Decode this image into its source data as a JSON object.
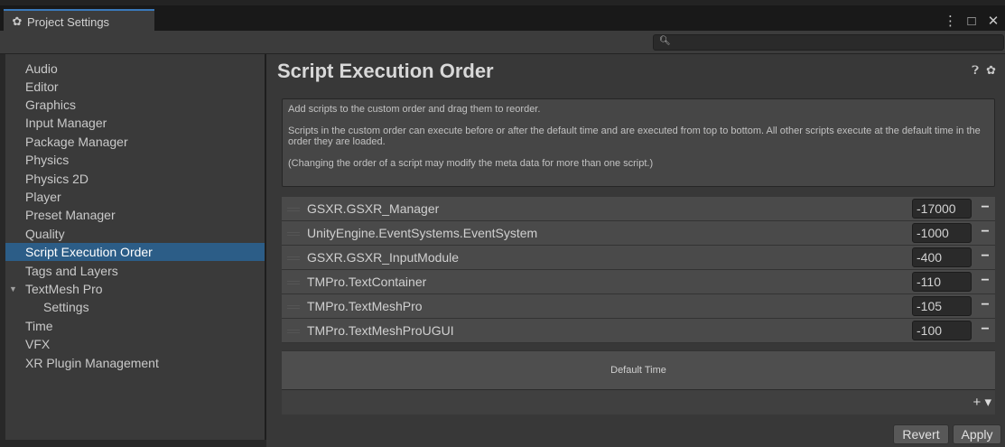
{
  "window": {
    "tab_title": "Project Settings",
    "tab_icon": "gear-icon",
    "controls": [
      "⋮",
      "□",
      "✕"
    ]
  },
  "search": {
    "placeholder": "",
    "value": ""
  },
  "sidebar": {
    "items": [
      {
        "label": "Audio"
      },
      {
        "label": "Editor"
      },
      {
        "label": "Graphics"
      },
      {
        "label": "Input Manager"
      },
      {
        "label": "Package Manager"
      },
      {
        "label": "Physics"
      },
      {
        "label": "Physics 2D"
      },
      {
        "label": "Player"
      },
      {
        "label": "Preset Manager"
      },
      {
        "label": "Quality"
      },
      {
        "label": "Script Execution Order",
        "selected": true
      },
      {
        "label": "Tags and Layers"
      },
      {
        "label": "TextMesh Pro",
        "expanded": true
      },
      {
        "label": "Settings",
        "child": true
      },
      {
        "label": "Time"
      },
      {
        "label": "VFX"
      },
      {
        "label": "XR Plugin Management"
      }
    ]
  },
  "main": {
    "title": "Script Execution Order",
    "help": {
      "line1": "Add scripts to the custom order and drag them to reorder.",
      "line2": "Scripts in the custom order can execute before or after the default time and are executed from top to bottom. All other scripts execute at the default time in the order they are loaded.",
      "line3": "(Changing the order of a script may modify the meta data for more than one script.)"
    },
    "scripts": [
      {
        "name": "GSXR.GSXR_Manager",
        "order": "-17000"
      },
      {
        "name": "UnityEngine.EventSystems.EventSystem",
        "order": "-1000"
      },
      {
        "name": "GSXR.GSXR_InputModule",
        "order": "-400"
      },
      {
        "name": "TMPro.TextContainer",
        "order": "-110"
      },
      {
        "name": "TMPro.TextMeshPro",
        "order": "-105"
      },
      {
        "name": "TMPro.TextMeshProUGUI",
        "order": "-100"
      }
    ],
    "default_time_label": "Default Time",
    "add_label": "+ ▾",
    "revert_label": "Revert",
    "apply_label": "Apply"
  },
  "colors": {
    "selection": "#2c5d87",
    "accent": "#3a79bb",
    "background": "#383838"
  }
}
